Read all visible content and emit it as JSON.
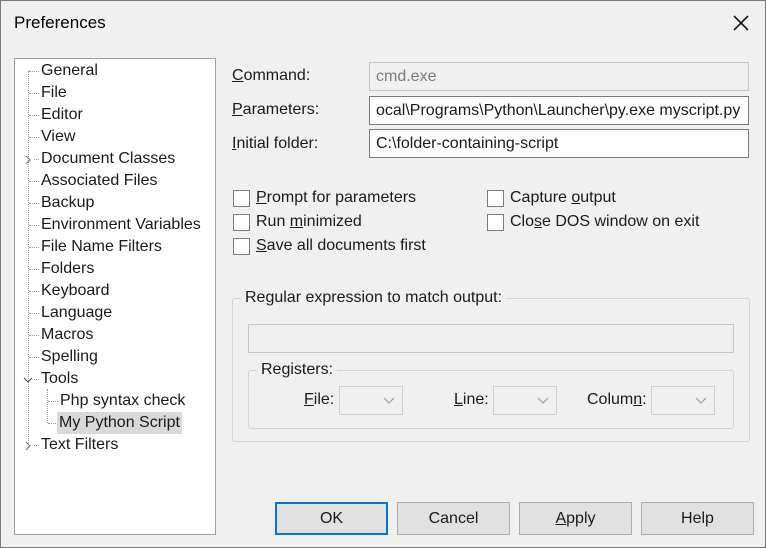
{
  "window": {
    "title": "Preferences"
  },
  "tree": {
    "items": [
      {
        "label": "General"
      },
      {
        "label": "File"
      },
      {
        "label": "Editor"
      },
      {
        "label": "View"
      },
      {
        "label": "Document Classes"
      },
      {
        "label": "Associated Files"
      },
      {
        "label": "Backup"
      },
      {
        "label": "Environment Variables"
      },
      {
        "label": "File Name Filters"
      },
      {
        "label": "Folders"
      },
      {
        "label": "Keyboard"
      },
      {
        "label": "Language"
      },
      {
        "label": "Macros"
      },
      {
        "label": "Spelling"
      },
      {
        "label": "Tools"
      },
      {
        "label": "Php syntax check"
      },
      {
        "label": "My Python Script"
      },
      {
        "label": "Text Filters"
      }
    ],
    "selected": "My Python Script"
  },
  "form": {
    "command": {
      "label_key": "C",
      "label_rest": "ommand:",
      "value": "cmd.exe"
    },
    "parameters": {
      "label_key": "P",
      "label_rest": "arameters:",
      "value": "ocal\\Programs\\Python\\Launcher\\py.exe myscript.py"
    },
    "initial_folder": {
      "label_key": "I",
      "label_rest": "nitial folder:",
      "value": "C:\\folder-containing-script"
    },
    "checkboxes": {
      "prompt": {
        "key": "P",
        "rest": "rompt for parameters",
        "checked": false
      },
      "run_min_pre": "Run ",
      "run_min_key": "m",
      "run_min_post": "inimized",
      "save_all": {
        "key": "S",
        "rest": "ave all documents first",
        "checked": false
      },
      "capture_pre": "Capture ",
      "capture_key": "o",
      "capture_post": "utput",
      "close_pre": "Clo",
      "close_key": "s",
      "close_post": "e DOS window on exit"
    },
    "regex_group": {
      "legend": "Regular expression to match output:",
      "value": ""
    },
    "registers": {
      "legend": "Registers:",
      "file_key": "F",
      "file_rest": "ile:",
      "line_key": "L",
      "line_rest": "ine:",
      "column_pre": "Colum",
      "column_key": "n",
      "column_post": ":"
    }
  },
  "buttons": {
    "ok": "OK",
    "cancel": "Cancel",
    "apply_key": "A",
    "apply_rest": "pply",
    "help": "Help"
  },
  "colors": {
    "accent": "#0078d4",
    "selected_bg": "#d9d9d9"
  }
}
